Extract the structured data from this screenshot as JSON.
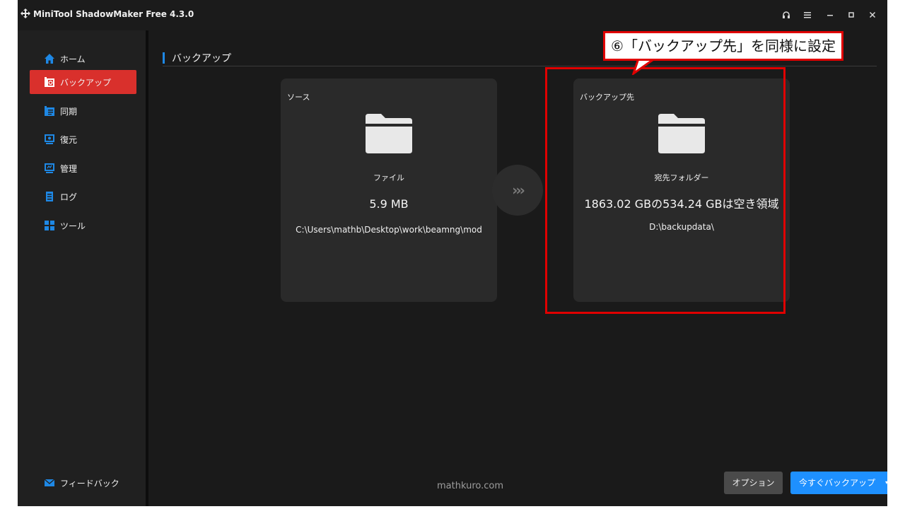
{
  "titlebar": {
    "title": "MiniTool ShadowMaker Free 4.3.0",
    "controls": [
      "headset-icon",
      "menu-icon",
      "minimize-icon",
      "maximize-icon",
      "close-icon"
    ]
  },
  "sidebar": {
    "items": [
      {
        "label": "ホーム",
        "icon": "home-icon",
        "active": false
      },
      {
        "label": "バックアップ",
        "icon": "backup-icon",
        "active": true
      },
      {
        "label": "同期",
        "icon": "sync-icon",
        "active": false
      },
      {
        "label": "復元",
        "icon": "restore-icon",
        "active": false
      },
      {
        "label": "管理",
        "icon": "manage-icon",
        "active": false
      },
      {
        "label": "ログ",
        "icon": "log-icon",
        "active": false
      },
      {
        "label": "ツール",
        "icon": "tools-icon",
        "active": false
      }
    ],
    "feedback_label": "フィードバック"
  },
  "main": {
    "section_title": "バックアップ",
    "source": {
      "label": "ソース",
      "type": "ファイル",
      "size": "5.9 MB",
      "path": "C:\\Users\\mathb\\Desktop\\work\\beamng\\mod"
    },
    "destination": {
      "label": "バックアップ先",
      "type": "宛先フォルダー",
      "space": "1863.02 GBの534.24 GBは空き領域",
      "path": "D:\\backupdata\\"
    },
    "arrow": "›››",
    "watermark": "mathkuro.com"
  },
  "footer": {
    "options_label": "オプション",
    "backup_now_label": "今すぐバックアップ",
    "backup_now_caret": "▾"
  },
  "annotation": {
    "callout_text": "⑥「バックアップ先」を同様に設定"
  },
  "colors": {
    "accent_red": "#d9302c",
    "accent_blue": "#1e90ff",
    "annotation_red": "#e00000",
    "background": "#1a1a1a",
    "card": "#2a2a2a"
  }
}
